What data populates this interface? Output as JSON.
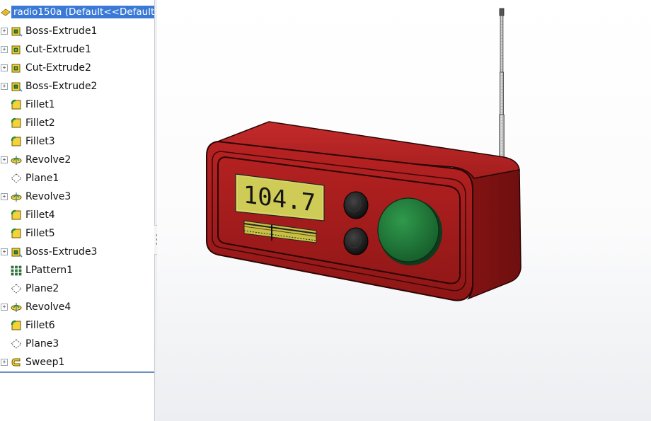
{
  "feature_tree": {
    "root": {
      "label": "radio150a  (Default<<Default"
    },
    "items": [
      {
        "label": "Boss-Extrude1",
        "icon": "boss-extrude-icon",
        "expandable": true
      },
      {
        "label": "Cut-Extrude1",
        "icon": "cut-extrude-icon",
        "expandable": true
      },
      {
        "label": "Cut-Extrude2",
        "icon": "cut-extrude-icon",
        "expandable": true
      },
      {
        "label": "Boss-Extrude2",
        "icon": "boss-extrude-icon",
        "expandable": true
      },
      {
        "label": "Fillet1",
        "icon": "fillet-icon",
        "expandable": false
      },
      {
        "label": "Fillet2",
        "icon": "fillet-icon",
        "expandable": false
      },
      {
        "label": "Fillet3",
        "icon": "fillet-icon",
        "expandable": false
      },
      {
        "label": "Revolve2",
        "icon": "revolve-icon",
        "expandable": true
      },
      {
        "label": "Plane1",
        "icon": "plane-icon",
        "expandable": false
      },
      {
        "label": "Revolve3",
        "icon": "revolve-icon",
        "expandable": true
      },
      {
        "label": "Fillet4",
        "icon": "fillet-icon",
        "expandable": false
      },
      {
        "label": "Fillet5",
        "icon": "fillet-icon",
        "expandable": false
      },
      {
        "label": "Boss-Extrude3",
        "icon": "boss-extrude-icon",
        "expandable": true
      },
      {
        "label": "LPattern1",
        "icon": "linear-pattern-icon",
        "expandable": false
      },
      {
        "label": "Plane2",
        "icon": "plane-icon",
        "expandable": false
      },
      {
        "label": "Revolve4",
        "icon": "revolve-icon",
        "expandable": true
      },
      {
        "label": "Fillet6",
        "icon": "fillet-icon",
        "expandable": false
      },
      {
        "label": "Plane3",
        "icon": "plane-icon",
        "expandable": false
      },
      {
        "label": "Sweep1",
        "icon": "sweep-icon",
        "expandable": true
      }
    ]
  },
  "model": {
    "display_value": "104.7",
    "colors": {
      "body": "#a01c1c",
      "body_dark": "#6e0f0f",
      "lcd": "#d9d565",
      "knob": "#1f7a3a",
      "buttons": "#1a1a1a"
    }
  },
  "colors": {
    "selection": "#3a7ad6",
    "panel_border": "#c8ccd2"
  }
}
